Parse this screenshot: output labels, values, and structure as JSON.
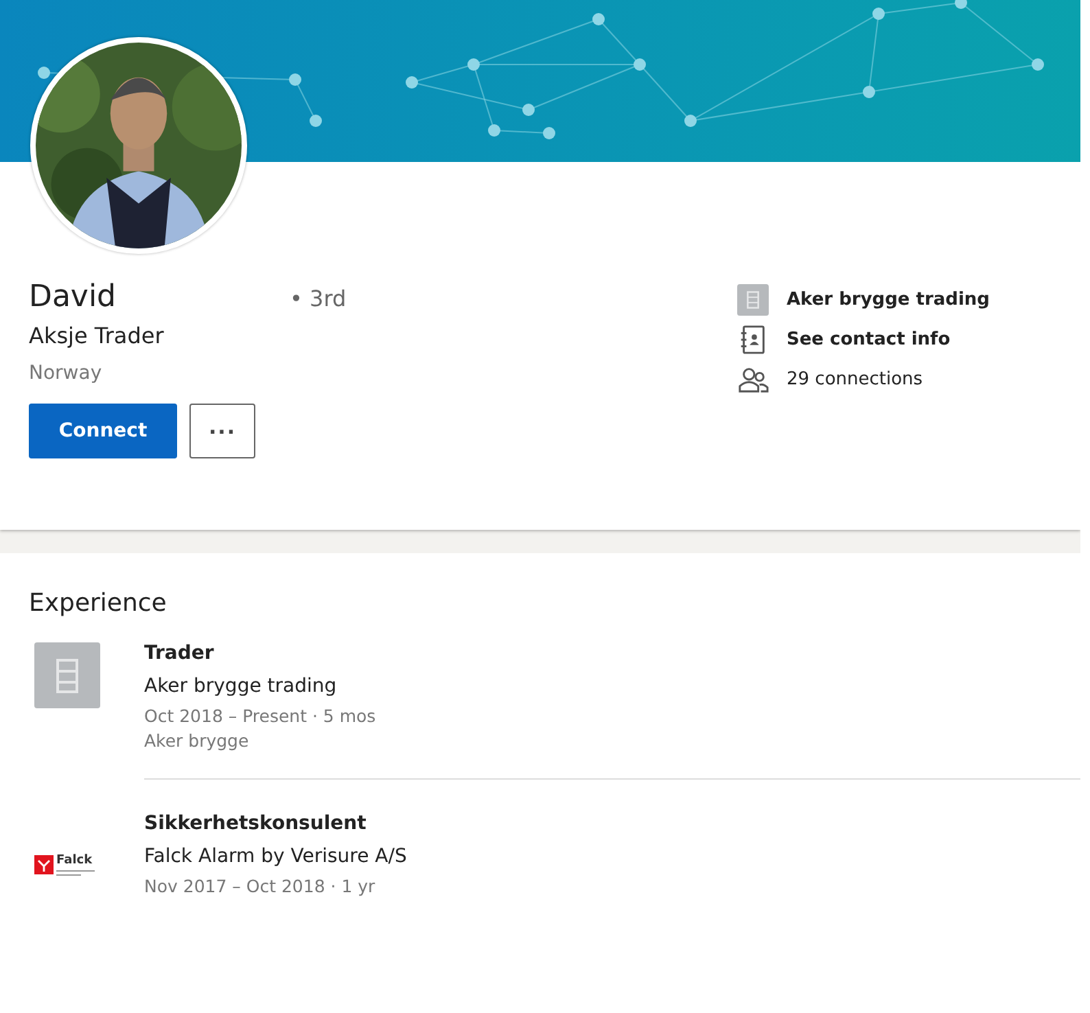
{
  "profile": {
    "name": "David",
    "degree": "• 3rd",
    "headline": "Aksje Trader",
    "location": "Norway",
    "actions": [
      {
        "kind": "primary",
        "label": "Connect"
      },
      {
        "kind": "more",
        "label": "..."
      }
    ],
    "info": [
      {
        "kind": "company",
        "text": "Aker brygge trading",
        "bold": true
      },
      {
        "kind": "contact",
        "text": "See contact info",
        "bold": true
      },
      {
        "kind": "connections",
        "text": "29 connections",
        "bold": false
      }
    ]
  },
  "experience": {
    "title": "Experience",
    "items": [
      {
        "kind": "building",
        "title": "Trader",
        "company": "Aker brygge trading",
        "dates": "Oct 2018 – Present · 5 mos",
        "location": "Aker brygge"
      },
      {
        "kind": "falck",
        "logo_text": "Falck",
        "title": "Sikkerhetskonsulent",
        "company": "Falck Alarm by Verisure A/S",
        "dates": "Nov 2017 – Oct 2018 · 1 yr"
      }
    ]
  }
}
